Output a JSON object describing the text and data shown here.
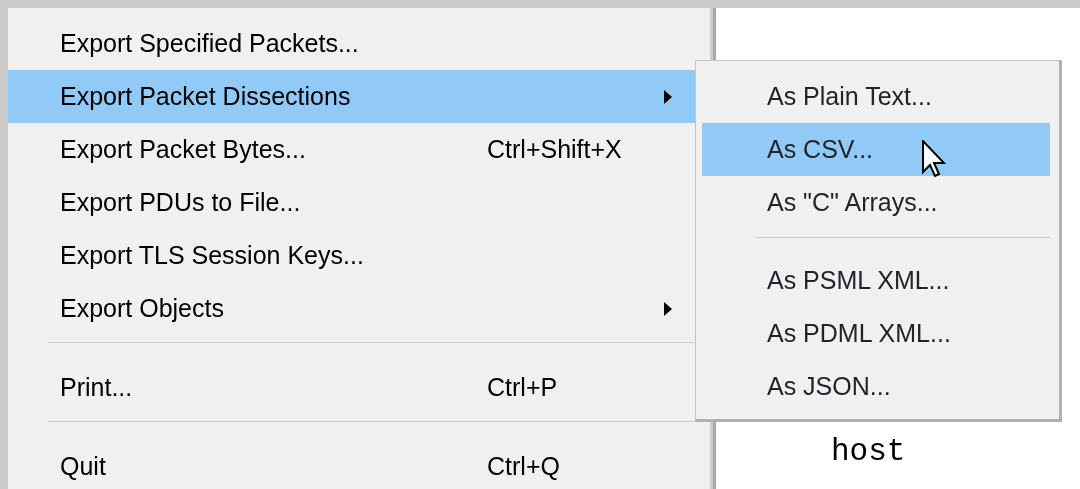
{
  "menu": {
    "items": [
      {
        "kind": "item",
        "label": "Export Specified Packets...",
        "selected": false
      },
      {
        "kind": "submenu",
        "label": "Export Packet Dissections",
        "selected": true
      },
      {
        "kind": "item",
        "label": "Export Packet Bytes...",
        "shortcut": "Ctrl+Shift+X",
        "selected": false
      },
      {
        "kind": "item",
        "label": "Export PDUs to File...",
        "selected": false
      },
      {
        "kind": "item",
        "label": "Export TLS Session Keys...",
        "selected": false
      },
      {
        "kind": "submenu",
        "label": "Export Objects",
        "selected": false
      },
      {
        "kind": "separator"
      },
      {
        "kind": "item",
        "label": "Print...",
        "shortcut": "Ctrl+P",
        "selected": false
      },
      {
        "kind": "separator"
      },
      {
        "kind": "item",
        "label": "Quit",
        "shortcut": "Ctrl+Q",
        "selected": false
      }
    ]
  },
  "submenu": {
    "items": [
      {
        "kind": "item",
        "label": "As Plain Text...",
        "selected": false
      },
      {
        "kind": "item",
        "label": "As CSV...",
        "selected": true
      },
      {
        "kind": "item",
        "label": "As \"C\" Arrays...",
        "selected": false
      },
      {
        "kind": "separator"
      },
      {
        "kind": "item",
        "label": "As PSML XML...",
        "selected": false
      },
      {
        "kind": "item",
        "label": "As PDML XML...",
        "selected": false
      },
      {
        "kind": "item",
        "label": "As JSON...",
        "selected": false
      }
    ]
  },
  "background_list": {
    "lines": [
      "host"
    ]
  }
}
